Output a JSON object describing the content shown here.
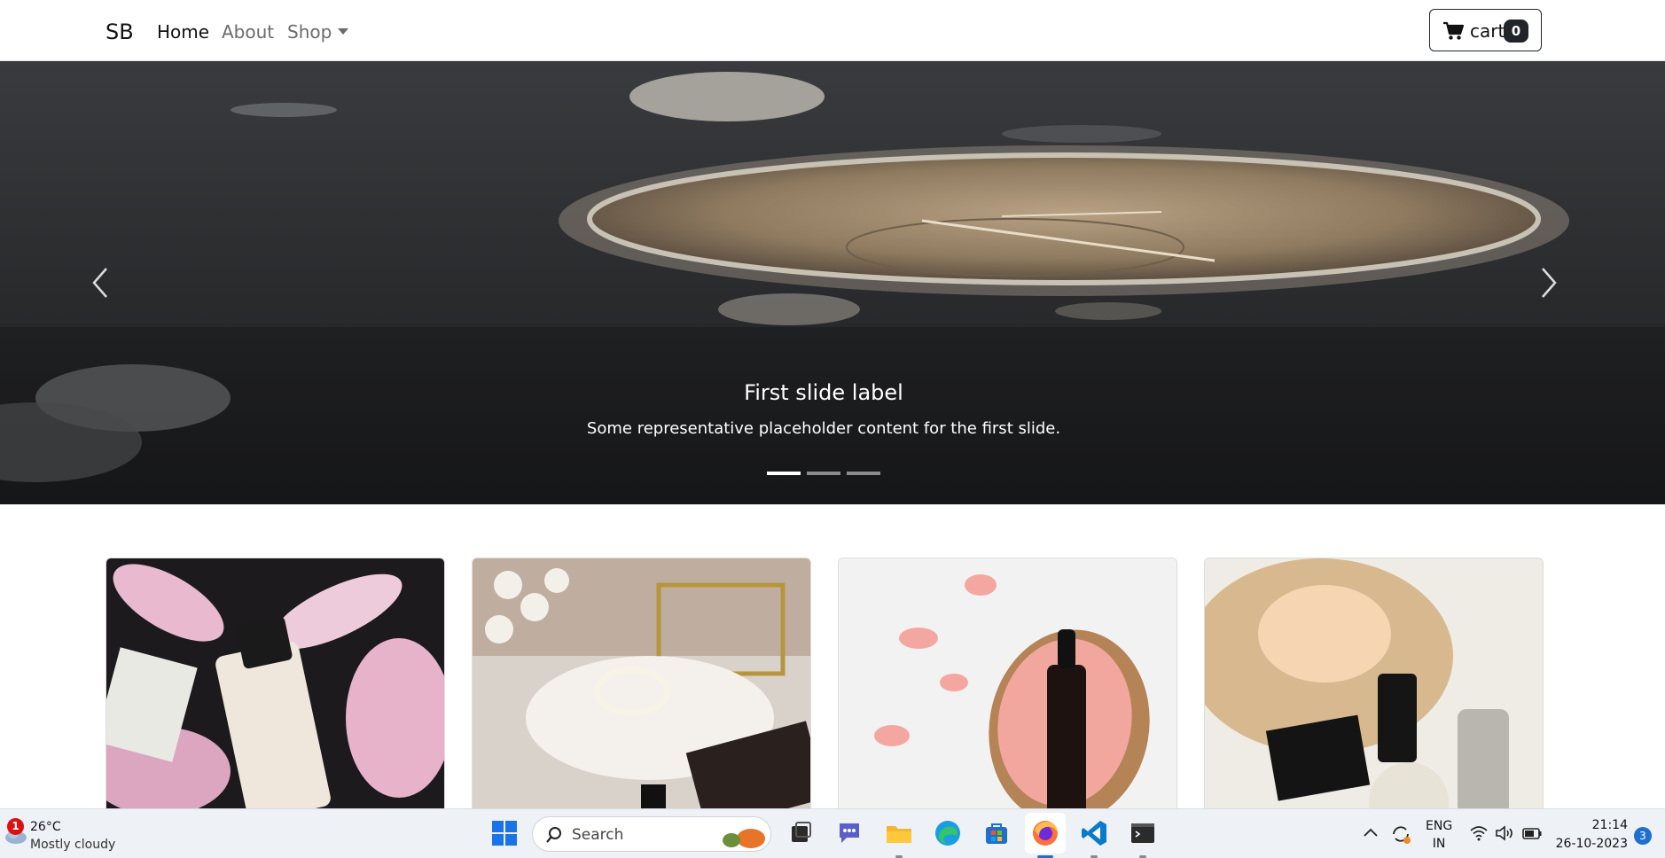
{
  "navbar": {
    "brand": "SB",
    "links": [
      "Home",
      "About",
      "Shop"
    ],
    "cart_label": "cart",
    "cart_count": "0"
  },
  "carousel": {
    "caption_title": "First slide label",
    "caption_text": "Some representative placeholder content for the first slide.",
    "slide_count": 3,
    "active_slide": 1
  },
  "products": {
    "cards": [
      "foundation-bottle-petals",
      "jewelry-pearls-palette",
      "serum-bottle-rose-petals",
      "gift-basket-products"
    ]
  },
  "taskbar": {
    "weather_badge": "1",
    "weather_temp": "26°C",
    "weather_desc": "Mostly cloudy",
    "search_label": "Search",
    "lang_top": "ENG",
    "lang_bottom": "IN",
    "time": "21:14",
    "date": "26-10-2023",
    "notifications": "3"
  },
  "colors": {
    "accent": "#212529",
    "taskbar": "#eef1f5"
  }
}
